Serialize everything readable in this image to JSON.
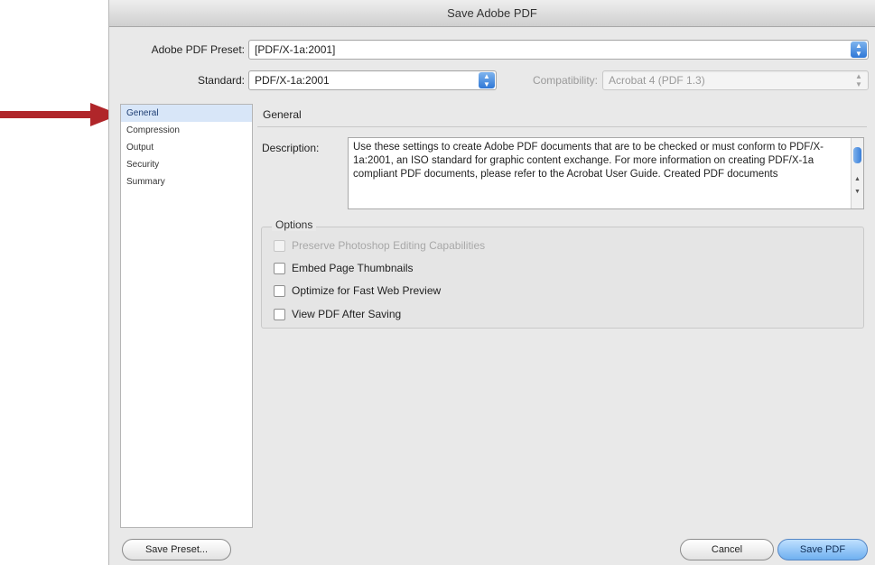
{
  "window": {
    "title": "Save Adobe PDF"
  },
  "preset": {
    "label": "Adobe PDF Preset:",
    "value": "[PDF/X-1a:2001]"
  },
  "standard": {
    "label": "Standard:",
    "value": "PDF/X-1a:2001"
  },
  "compatibility": {
    "label": "Compatibility:",
    "value": "Acrobat 4 (PDF 1.3)"
  },
  "sidebar": {
    "items": [
      {
        "label": "General",
        "selected": true
      },
      {
        "label": "Compression",
        "selected": false
      },
      {
        "label": "Output",
        "selected": false
      },
      {
        "label": "Security",
        "selected": false
      },
      {
        "label": "Summary",
        "selected": false
      }
    ]
  },
  "panel": {
    "title": "General",
    "description_label": "Description:",
    "description": "Use these settings to create Adobe PDF documents that are to be checked or must conform to PDF/X-1a:2001, an ISO standard for graphic content exchange.  For more information on creating PDF/X-1a compliant PDF documents, please refer to the Acrobat User Guide.  Created PDF documents"
  },
  "options": {
    "legend": "Options",
    "items": [
      {
        "label": "Preserve Photoshop Editing Capabilities",
        "checked": false,
        "enabled": false
      },
      {
        "label": "Embed Page Thumbnails",
        "checked": false,
        "enabled": true
      },
      {
        "label": "Optimize for Fast Web Preview",
        "checked": false,
        "enabled": true
      },
      {
        "label": "View PDF After Saving",
        "checked": false,
        "enabled": true
      }
    ]
  },
  "buttons": {
    "save_preset": "Save Preset...",
    "cancel": "Cancel",
    "save_pdf": "Save PDF"
  },
  "colors": {
    "arrow": "#b0262a",
    "default_button": "#6fb0f0",
    "selection": "#d8e6f8"
  }
}
